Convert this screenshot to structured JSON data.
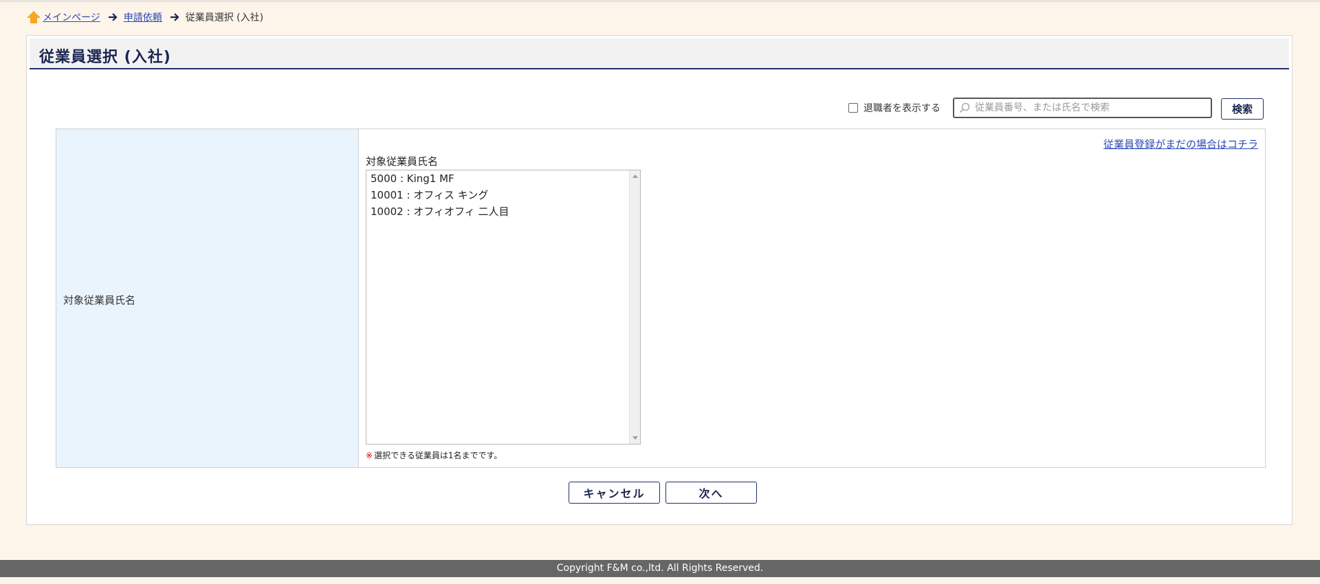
{
  "breadcrumb": {
    "home_label": "メインページ",
    "request_label": "申請依頼",
    "current_label": "従業員選択 (入社)"
  },
  "page": {
    "title": "従業員選択 (入社)"
  },
  "search": {
    "show_retired_label": "退職者を表示する",
    "show_retired_checked": false,
    "placeholder": "従業員番号、または氏名で検索",
    "value": "",
    "button_label": "検索"
  },
  "form": {
    "row_label": "対象従業員氏名",
    "register_link": "従業員登録がまだの場合はコチラ",
    "field_label": "対象従業員氏名",
    "employees": [
      "5000 : King1 MF",
      "10001 : オフィス キング",
      "10002 : オフィオフィ 二人目"
    ],
    "note_mark": "※",
    "note_text": "選択できる従業員は1名までです。"
  },
  "actions": {
    "cancel_label": "キャンセル",
    "next_label": "次へ"
  },
  "footer": {
    "copyright": "Copyright F&M co.,ltd. All Rights Reserved."
  },
  "colors": {
    "background": "#fdf5ea",
    "accent_navy": "#1f2f6b",
    "label_cell_bg": "#eaf4fd",
    "link": "#2b49b8",
    "home_icon": "#f5a623",
    "footer_bg": "#666666"
  }
}
